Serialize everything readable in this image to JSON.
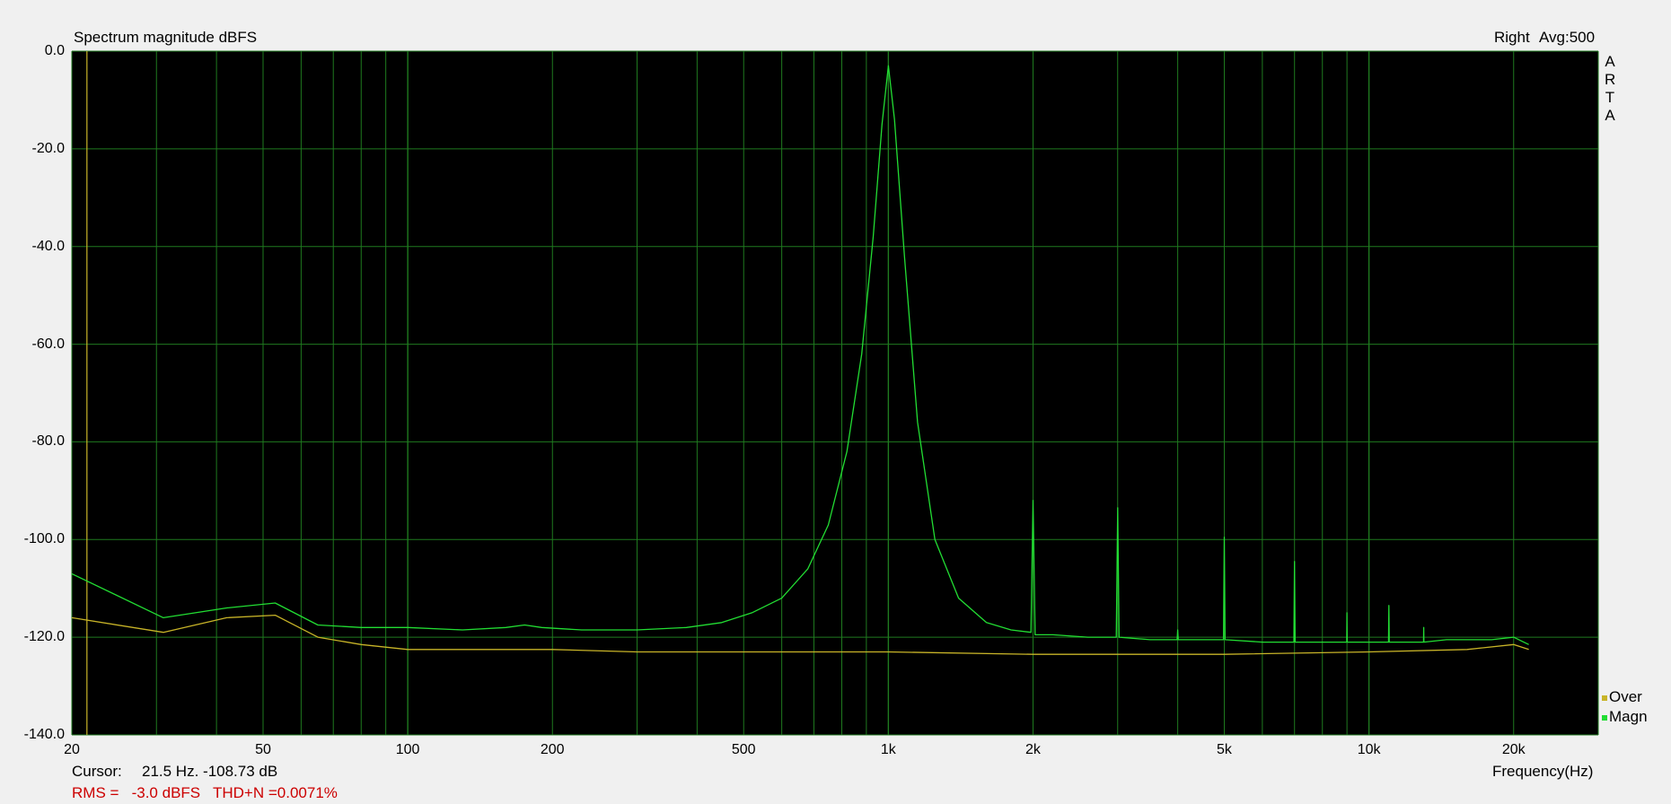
{
  "header": {
    "title": "Spectrum magnitude dBFS",
    "channel": "Right",
    "avg": "Avg:500"
  },
  "side_brand": [
    "A",
    "R",
    "T",
    "A"
  ],
  "footer": {
    "cursor_label": "Cursor:",
    "cursor_value": "21.5 Hz. -108.73 dB",
    "rms_line": "RMS =   -3.0 dBFS   THD+N =0.0071%"
  },
  "colors": {
    "background": "#000000",
    "grid": "#1f7a1f",
    "magn": "#22dd33",
    "over": "#c8b428",
    "cursor": "#c8b428"
  },
  "chart_data": {
    "type": "line",
    "title": "Spectrum magnitude dBFS",
    "xlabel": "Frequency(Hz)",
    "ylabel": "",
    "x_scale": "log",
    "xlim": [
      20,
      30000
    ],
    "ylim": [
      -140,
      0
    ],
    "grid": true,
    "legend_position": "bottom-right",
    "y_ticks": [
      "0.0",
      "-20.0",
      "-40.0",
      "-60.0",
      "-80.0",
      "-100.0",
      "-120.0",
      "-140.0"
    ],
    "y_tick_values": [
      0,
      -20,
      -40,
      -60,
      -80,
      -100,
      -120,
      -140
    ],
    "x_ticks": [
      "20",
      "50",
      "100",
      "200",
      "500",
      "1k",
      "2k",
      "5k",
      "10k",
      "20k"
    ],
    "x_tick_values": [
      20,
      50,
      100,
      200,
      500,
      1000,
      2000,
      5000,
      10000,
      20000
    ],
    "cursor_x": 21.5,
    "series": [
      {
        "name": "Magn",
        "color": "#22dd33",
        "x": [
          20,
          31,
          42,
          53,
          65,
          80,
          100,
          130,
          160,
          175,
          190,
          230,
          300,
          380,
          450,
          520,
          600,
          680,
          750,
          820,
          880,
          930,
          970,
          1000,
          1030,
          1080,
          1150,
          1250,
          1400,
          1600,
          1800,
          1980,
          2000,
          2020,
          2200,
          2600,
          2980,
          3000,
          3020,
          3500,
          3990,
          4000,
          4010,
          4500,
          4980,
          5000,
          5020,
          6000,
          6980,
          7000,
          7020,
          8000,
          8990,
          9000,
          9010,
          10000,
          10980,
          11000,
          11020,
          12000,
          12990,
          13000,
          13010,
          14500,
          16000,
          18000,
          20000,
          21500
        ],
        "y": [
          -107,
          -116,
          -114,
          -113,
          -117.5,
          -118,
          -118,
          -118.5,
          -118,
          -117.5,
          -118,
          -118.5,
          -118.5,
          -118,
          -117,
          -115,
          -112,
          -106,
          -97,
          -82,
          -62,
          -38,
          -15,
          -3,
          -14,
          -42,
          -76,
          -100,
          -112,
          -117,
          -118.5,
          -119,
          -92,
          -119.5,
          -119.5,
          -120,
          -120,
          -93.5,
          -120,
          -120.5,
          -120.5,
          -118.5,
          -120.5,
          -120.5,
          -120.5,
          -99.5,
          -120.5,
          -121,
          -121,
          -104.5,
          -121,
          -121,
          -121,
          -115,
          -121,
          -121,
          -121,
          -113.5,
          -121,
          -121,
          -121,
          -118,
          -121,
          -120.5,
          -120.5,
          -120.5,
          -120,
          -121.5
        ]
      },
      {
        "name": "Over",
        "color": "#c8b428",
        "x": [
          20,
          31,
          42,
          53,
          65,
          80,
          100,
          130,
          200,
          300,
          500,
          1000,
          2000,
          5000,
          10000,
          16000,
          20000,
          21500
        ],
        "y": [
          -116,
          -119,
          -116,
          -115.5,
          -120,
          -121.5,
          -122.5,
          -122.5,
          -122.5,
          -123,
          -123,
          -123,
          -123.5,
          -123.5,
          -123,
          -122.5,
          -121.5,
          -122.5
        ]
      }
    ]
  }
}
